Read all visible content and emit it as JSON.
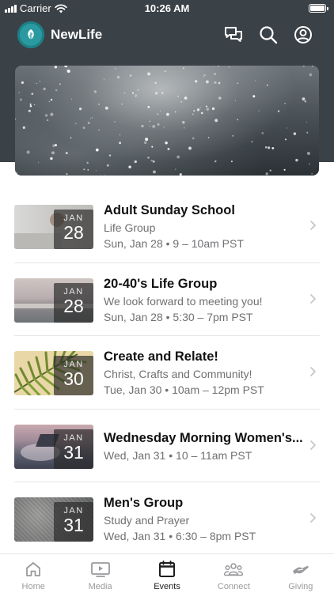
{
  "status_bar": {
    "carrier": "Carrier",
    "time": "10:26 AM"
  },
  "app": {
    "title": "NewLife"
  },
  "colors": {
    "header": "#3a4147",
    "logo": "#2b9aa0",
    "inactive_tab": "#9a9a9e"
  },
  "events": [
    {
      "title": "Adult Sunday School",
      "subtitle": "Life Group",
      "when": "Sun, Jan 28 • 9 – 10am PST",
      "month": "JAN",
      "day": "28",
      "thumb": "desk"
    },
    {
      "title": "20-40's Life Group",
      "subtitle": "We look forward to meeting you!",
      "when": "Sun, Jan 28 • 5:30 – 7pm PST",
      "month": "JAN",
      "day": "28",
      "thumb": "beach"
    },
    {
      "title": "Create and Relate!",
      "subtitle": "Christ, Crafts and Community!",
      "when": "Tue, Jan 30 • 10am – 12pm PST",
      "month": "JAN",
      "day": "30",
      "thumb": "palm"
    },
    {
      "title": "Wednesday Morning Women's...",
      "subtitle": "",
      "when": "Wed, Jan 31 • 10 – 11am PST",
      "month": "JAN",
      "day": "31",
      "thumb": "clouds"
    },
    {
      "title": "Men's Group",
      "subtitle": "Study and Prayer",
      "when": "Wed, Jan 31 • 6:30 – 8pm PST",
      "month": "JAN",
      "day": "31",
      "thumb": "stone"
    }
  ],
  "tabs": [
    {
      "label": "Home",
      "icon": "home-icon",
      "active": false
    },
    {
      "label": "Media",
      "icon": "media-icon",
      "active": false
    },
    {
      "label": "Events",
      "icon": "calendar-icon",
      "active": true
    },
    {
      "label": "Connect",
      "icon": "people-icon",
      "active": false
    },
    {
      "label": "Giving",
      "icon": "giving-icon",
      "active": false
    }
  ]
}
